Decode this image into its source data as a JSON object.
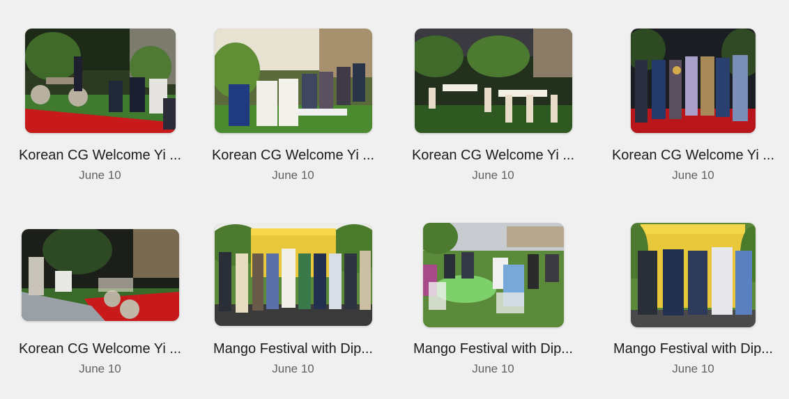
{
  "gallery": {
    "items": [
      {
        "title": "Korean CG Welcome Yi ...",
        "date": "June 10",
        "image": "garden-stage-photo"
      },
      {
        "title": "Korean CG Welcome Yi ...",
        "date": "June 10",
        "image": "seated-guests-photo"
      },
      {
        "title": "Korean CG Welcome Yi ...",
        "date": "June 10",
        "image": "dining-tables-photo"
      },
      {
        "title": "Korean CG Welcome Yi ...",
        "date": "June 10",
        "image": "group-presentation-photo"
      },
      {
        "title": "Korean CG Welcome Yi ...",
        "date": "June 10",
        "image": "podium-speaker-photo"
      },
      {
        "title": "Mango Festival with Dip...",
        "date": "June 10",
        "image": "banner-group-photo"
      },
      {
        "title": "Mango Festival with Dip...",
        "date": "June 10",
        "image": "lawn-seating-photo"
      },
      {
        "title": "Mango Festival with Dip...",
        "date": "June 10",
        "image": "banner-line-photo"
      }
    ]
  }
}
